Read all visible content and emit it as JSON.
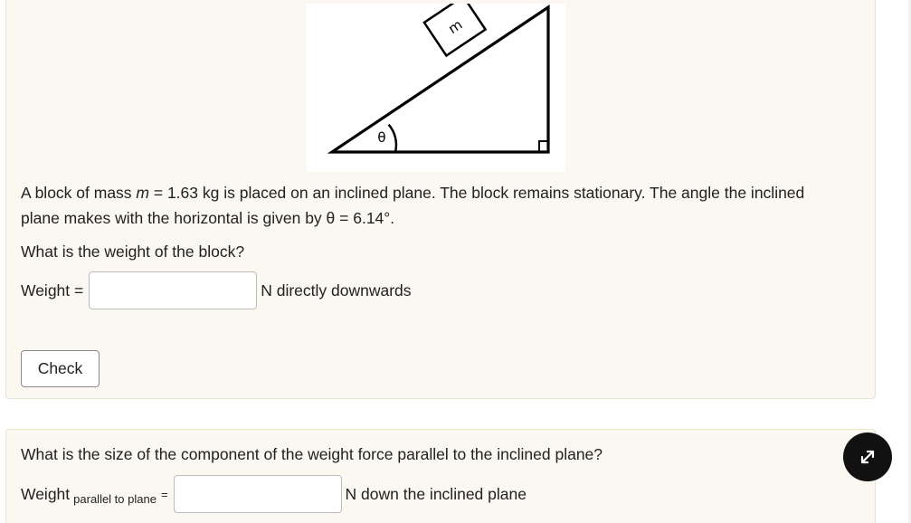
{
  "figure": {
    "mass_label": "m",
    "angle_label": "θ"
  },
  "question1": {
    "line1_pre": "A block of mass ",
    "line1_var": "m",
    "line1_post": " = 1.63 kg is placed on an inclined plane. The block remains stationary. The angle the inclined",
    "line2": "plane makes with the horizontal is given by θ = 6.14°.",
    "prompt": "What is the weight of the block?",
    "input_label": "Weight =",
    "input_value": "",
    "unit": "N directly downwards",
    "check_label": "Check"
  },
  "question2": {
    "prompt": "What is the size of the component of the weight force parallel to the inclined plane?",
    "input_label_main": "Weight",
    "input_label_sub": "parallel to plane",
    "input_label_eq": "=",
    "input_value": "",
    "unit": "N down the inclined plane"
  },
  "expand_button": {
    "icon": "expand-arrows-icon"
  },
  "colors": {
    "card_background": "#fbf7f1",
    "expand_button": "#111111"
  }
}
